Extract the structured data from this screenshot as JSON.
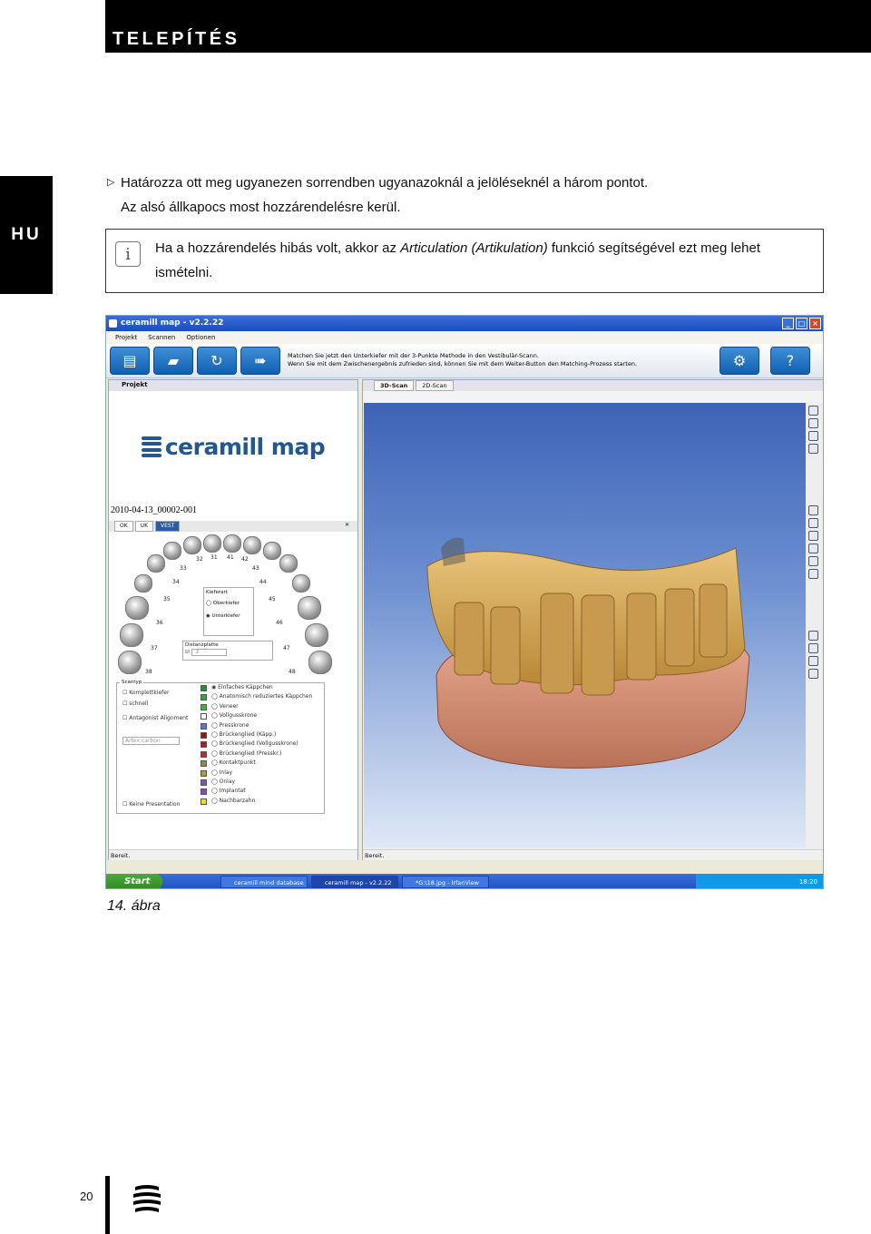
{
  "header": {
    "title": "TELEPÍTÉS"
  },
  "side_tab": {
    "language": "HU"
  },
  "bullet": {
    "line1": "Határozza ott meg ugyanezen sorrendben ugyanazoknál a jelöléseknél a három pontot.",
    "line2": "Az alsó állkapocs most hozzárendelésre kerül."
  },
  "note": {
    "text_before": "Ha a hozzárendelés hibás volt, akkor az ",
    "text_italic": "Articulation (Artikulation)",
    "text_after": " funkció segítségével ezt meg lehet ismételni."
  },
  "screenshot": {
    "window_title": "ceramill map - v2.2.22",
    "menu": [
      "Projekt",
      "Scannen",
      "Optionen"
    ],
    "hint_line1": "Matchen Sie jetzt den Unterkiefer mit der 3-Punkte Methode in den Vestibulär-Scann.",
    "hint_line2": "Wenn Sie mit dem Zwischenergebnis zufrieden sind, können Sie mit dem Weiter-Button den Matching-Prozess starten.",
    "left_tab": "Projekt",
    "logo_text": "ceramill map",
    "project_id": "2010-04-13_00002-001",
    "jaw_tabs": [
      "OK",
      "UK",
      "VEST"
    ],
    "tooth_numbers": [
      "32",
      "31",
      "41",
      "42",
      "33",
      "43",
      "34",
      "44",
      "35",
      "45",
      "36",
      "46",
      "37",
      "47",
      "38",
      "48"
    ],
    "kiefer": {
      "label": "Kieferart",
      "opt1": "Oberkiefer",
      "opt2": "Unterkiefer"
    },
    "distanz": {
      "label": "Distanzplatte",
      "value": "2"
    },
    "scantyp": {
      "label": "Scantyp",
      "checks": [
        "Komplettkiefer",
        "schnell",
        "Antagonist Alignment"
      ],
      "select": "Artex carbon",
      "types": [
        "Einfaches Käppchen",
        "Anatomisch reduziertes Käppchen",
        "Veneer",
        "Vollgusskrone",
        "Presskrone",
        "Brückenglied (Käpp.)",
        "Brückenglied (Vollgusskrone)",
        "Brückenglied (Presskr.)",
        "Kontaktpunkt",
        "Inlay",
        "Onlay",
        "Implantat",
        "Nachbarzahn"
      ],
      "colors": [
        "#2e8b3e",
        "#3aa04a",
        "#48b048",
        "#ffffff",
        "#5a7acc",
        "#8b1a1a",
        "#a02020",
        "#b03030",
        "#8a8a50",
        "#aa9a40",
        "#7a5aa0",
        "#8a4ab0",
        "#e8e020"
      ],
      "presentation": "Keine Presentation"
    },
    "status_left": "Bereit.",
    "right_tabs": [
      "3D-Scan",
      "2D-Scan"
    ],
    "status_right": "Bereit.",
    "taskbar": {
      "start": "Start",
      "tasks": [
        "ceramill mind database",
        "ceramill map - v2.2.22",
        "*G:\\18.jpg - IrfanView"
      ],
      "clock": "18:20"
    }
  },
  "caption": "14. ábra",
  "footer": {
    "page_number": "20"
  }
}
